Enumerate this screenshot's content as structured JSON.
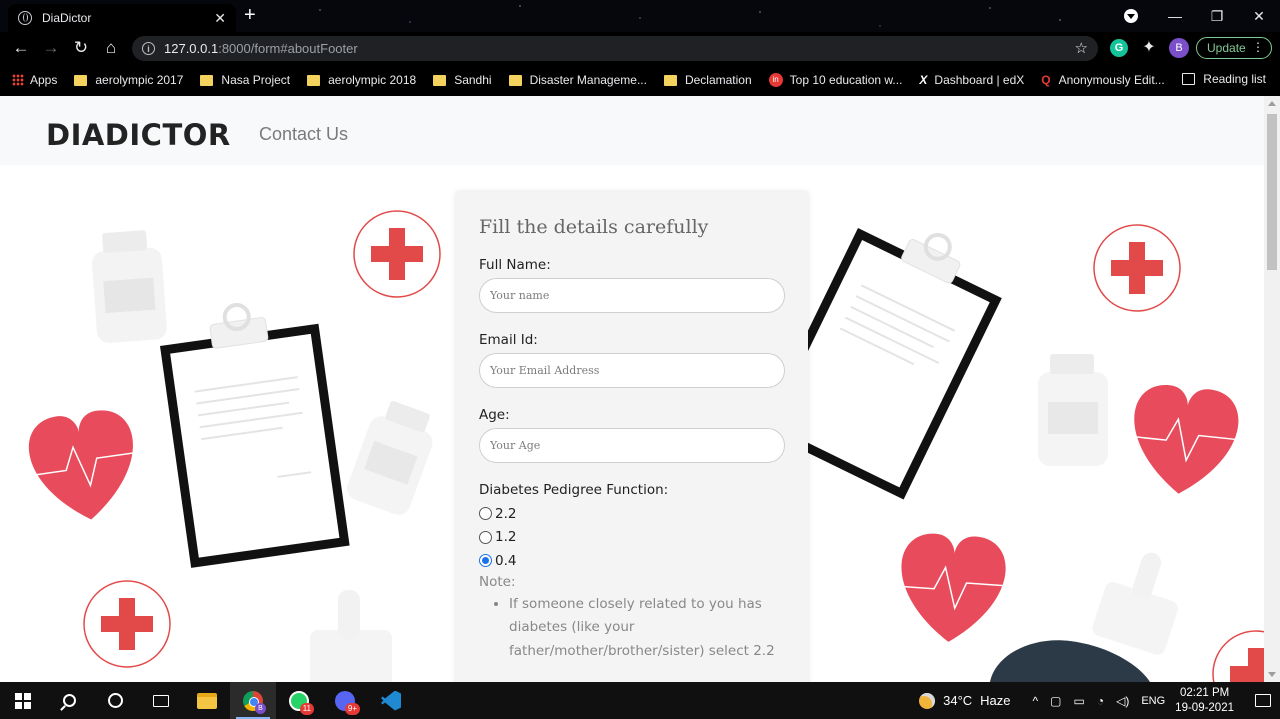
{
  "browser": {
    "tab_title": "DiaDictor",
    "tab_close": "✕",
    "new_tab": "+",
    "url_host": "127.0.0.1",
    "url_rest": ":8000/form#aboutFooter",
    "update_label": "Update",
    "profile_initial": "B",
    "bookmarks": [
      {
        "label": "Apps",
        "icon": "apps-grid-icon"
      },
      {
        "label": "aerolympic 2017",
        "icon": "folder-icon"
      },
      {
        "label": "Nasa Project",
        "icon": "folder-icon"
      },
      {
        "label": "aerolympic 2018",
        "icon": "folder-icon"
      },
      {
        "label": "Sandhi",
        "icon": "folder-icon"
      },
      {
        "label": "Disaster Manageme...",
        "icon": "folder-icon"
      },
      {
        "label": "Declamation",
        "icon": "folder-icon"
      },
      {
        "label": "Top 10 education w...",
        "icon": "site-icon"
      },
      {
        "label": "Dashboard | edX",
        "icon": "edx-icon"
      },
      {
        "label": "Anonymously Edit...",
        "icon": "quora-icon"
      }
    ],
    "reading_list": "Reading list"
  },
  "site": {
    "brand": "DIADICTOR",
    "nav_contact": "Contact Us"
  },
  "form": {
    "title": "Fill the details carefully",
    "full_name_label": "Full Name:",
    "full_name_placeholder": "Your name",
    "email_label": "Email Id:",
    "email_placeholder": "Your Email Address",
    "age_label": "Age:",
    "age_placeholder": "Your Age",
    "dpf_label": "Diabetes Pedigree Function:",
    "dpf_options": [
      {
        "label": "2.2",
        "checked": false
      },
      {
        "label": "1.2",
        "checked": false
      },
      {
        "label": "0.4",
        "checked": true
      }
    ],
    "note_label": "Note:",
    "note_items": [
      "If someone closely related to you has diabetes (like your father/mother/brother/sister) select 2.2"
    ]
  },
  "taskbar": {
    "whatsapp_badge": "11",
    "discord_badge": "9+",
    "chrome_profile": "B",
    "temperature": "34°C",
    "weather": "Haze",
    "language": "ENG",
    "time": "02:21 PM",
    "date": "19-09-2021"
  },
  "colors": {
    "accent_red": "#e84b5b",
    "outline_red": "#e24a4a",
    "brand_text": "#232323",
    "radio_checked": "#1a73e8"
  }
}
